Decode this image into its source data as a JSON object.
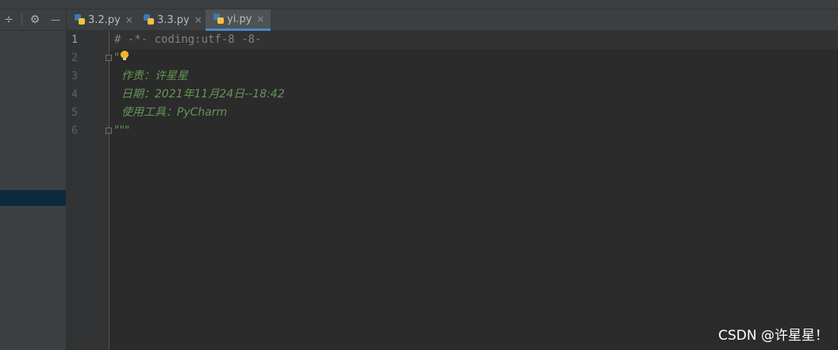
{
  "toolbar": {
    "icons": [
      "collapse-icon",
      "gear-icon",
      "minimize-icon"
    ],
    "collapse_glyph": "÷",
    "gear_glyph": "⚙",
    "minimize_glyph": "—"
  },
  "tabs": [
    {
      "label": "3.2.py",
      "active": false
    },
    {
      "label": "3.3.py",
      "active": false
    },
    {
      "label": "yi.py",
      "active": true
    }
  ],
  "tab_close_glyph": "×",
  "editor": {
    "line_numbers": [
      "1",
      "2",
      "3",
      "4",
      "5",
      "6"
    ],
    "lines": [
      "# -*- coding:utf-8 -8-",
      "\"\"\"",
      "  作责：许星星",
      "  日期：2021年11月24日--18:42",
      "  使用工具：PyCharm",
      "\"\"\""
    ]
  },
  "colors": {
    "background": "#2b2b2b",
    "comment": "#808080",
    "docstring": "#629755",
    "tab_underline": "#4a88c7"
  },
  "watermark": "CSDN @许星星！"
}
